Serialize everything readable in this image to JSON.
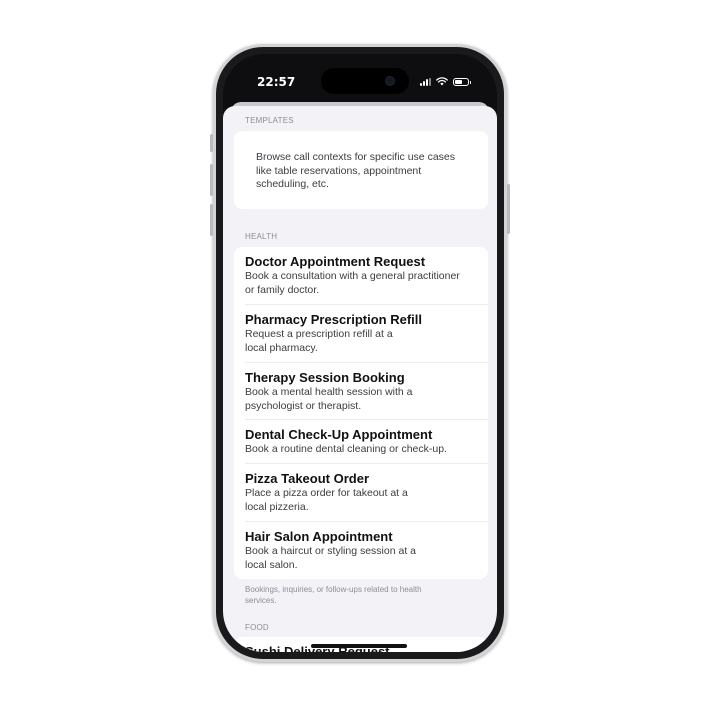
{
  "status_bar": {
    "time": "22:57"
  },
  "templates": {
    "header": "TEMPLATES",
    "description": "Browse call contexts for specific use cases like table reservations, appointment scheduling, etc."
  },
  "health": {
    "header": "HEALTH",
    "items": [
      {
        "title": "Doctor Appointment Request",
        "subtitle": "Book a consultation with a general practitioner or family doctor."
      },
      {
        "title": "Pharmacy Prescription Refill",
        "subtitle": "Request a prescription refill at a local pharmacy."
      },
      {
        "title": "Therapy Session Booking",
        "subtitle": "Book a mental health session with a psychologist or therapist."
      },
      {
        "title": "Dental Check-Up Appointment",
        "subtitle": "Book a routine dental cleaning or check-up."
      },
      {
        "title": "Pizza Takeout Order",
        "subtitle": "Place a pizza order for takeout at a local pizzeria."
      },
      {
        "title": "Hair Salon Appointment",
        "subtitle": "Book a haircut or styling session at a local salon."
      }
    ],
    "footer": "Bookings, inquiries, or follow-ups related to health services."
  },
  "food": {
    "header": "FOOD",
    "items": [
      {
        "title": "Sushi Delivery Request"
      }
    ]
  },
  "colors": {
    "background": "#f2f2f7",
    "card": "#ffffff",
    "secondary_text": "#8e8e93"
  }
}
